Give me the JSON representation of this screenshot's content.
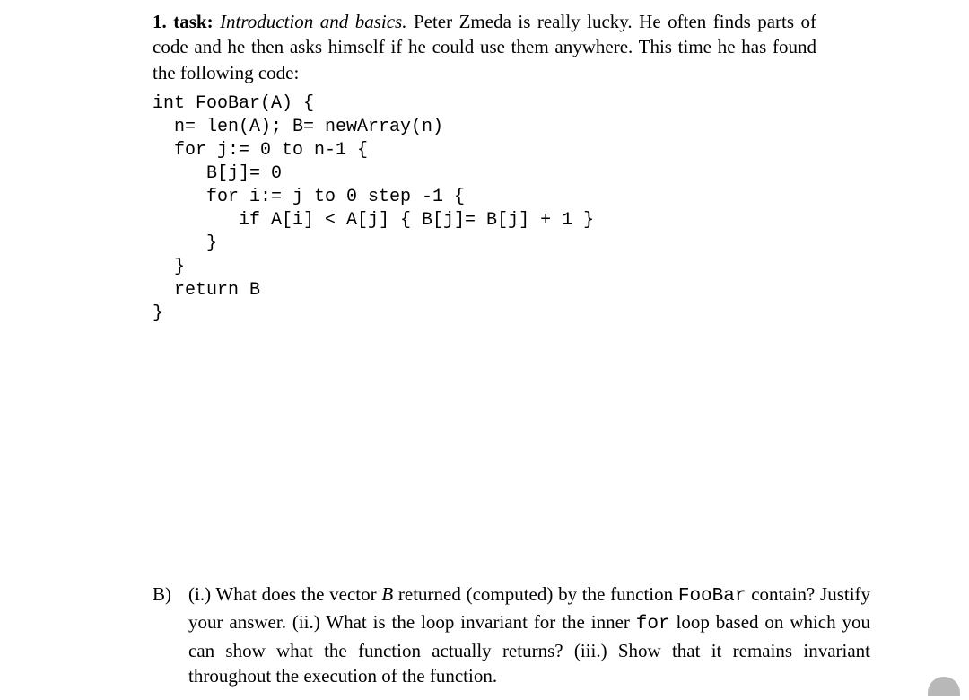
{
  "task": {
    "number": "1. task:",
    "title": "Introduction and basics.",
    "intro": "Peter Zmeda is really lucky. He often finds parts of code and he then asks himself if he could use them anywhere. This time he has found the following code:"
  },
  "code": {
    "lines": [
      "int FooBar(A) {",
      "  n= len(A); B= newArray(n)",
      "  for j:= 0 to n-1 {",
      "     B[j]= 0",
      "     for i:= j to 0 step -1 {",
      "        if A[i] < A[j] { B[j]= B[j] + 1 }",
      "     }",
      "  }",
      "  return B",
      "}"
    ]
  },
  "partB": {
    "label": "B)",
    "sub_i_label": "(i.)",
    "sub_i_text_1": "What does the vector ",
    "sub_i_var": "B",
    "sub_i_text_2": " returned (computed) by the function ",
    "sub_i_func": "FooBar",
    "sub_i_text_3": " contain? Justify your answer.",
    "sub_ii_label": "(ii.)",
    "sub_ii_text_1": "What is the loop invariant for the inner ",
    "sub_ii_code": "for",
    "sub_ii_text_2": " loop based on which you can show what the function actually returns?",
    "sub_iii_label": "(iii.)",
    "sub_iii_text": "Show that it remains invariant throughout the execution of the function."
  }
}
